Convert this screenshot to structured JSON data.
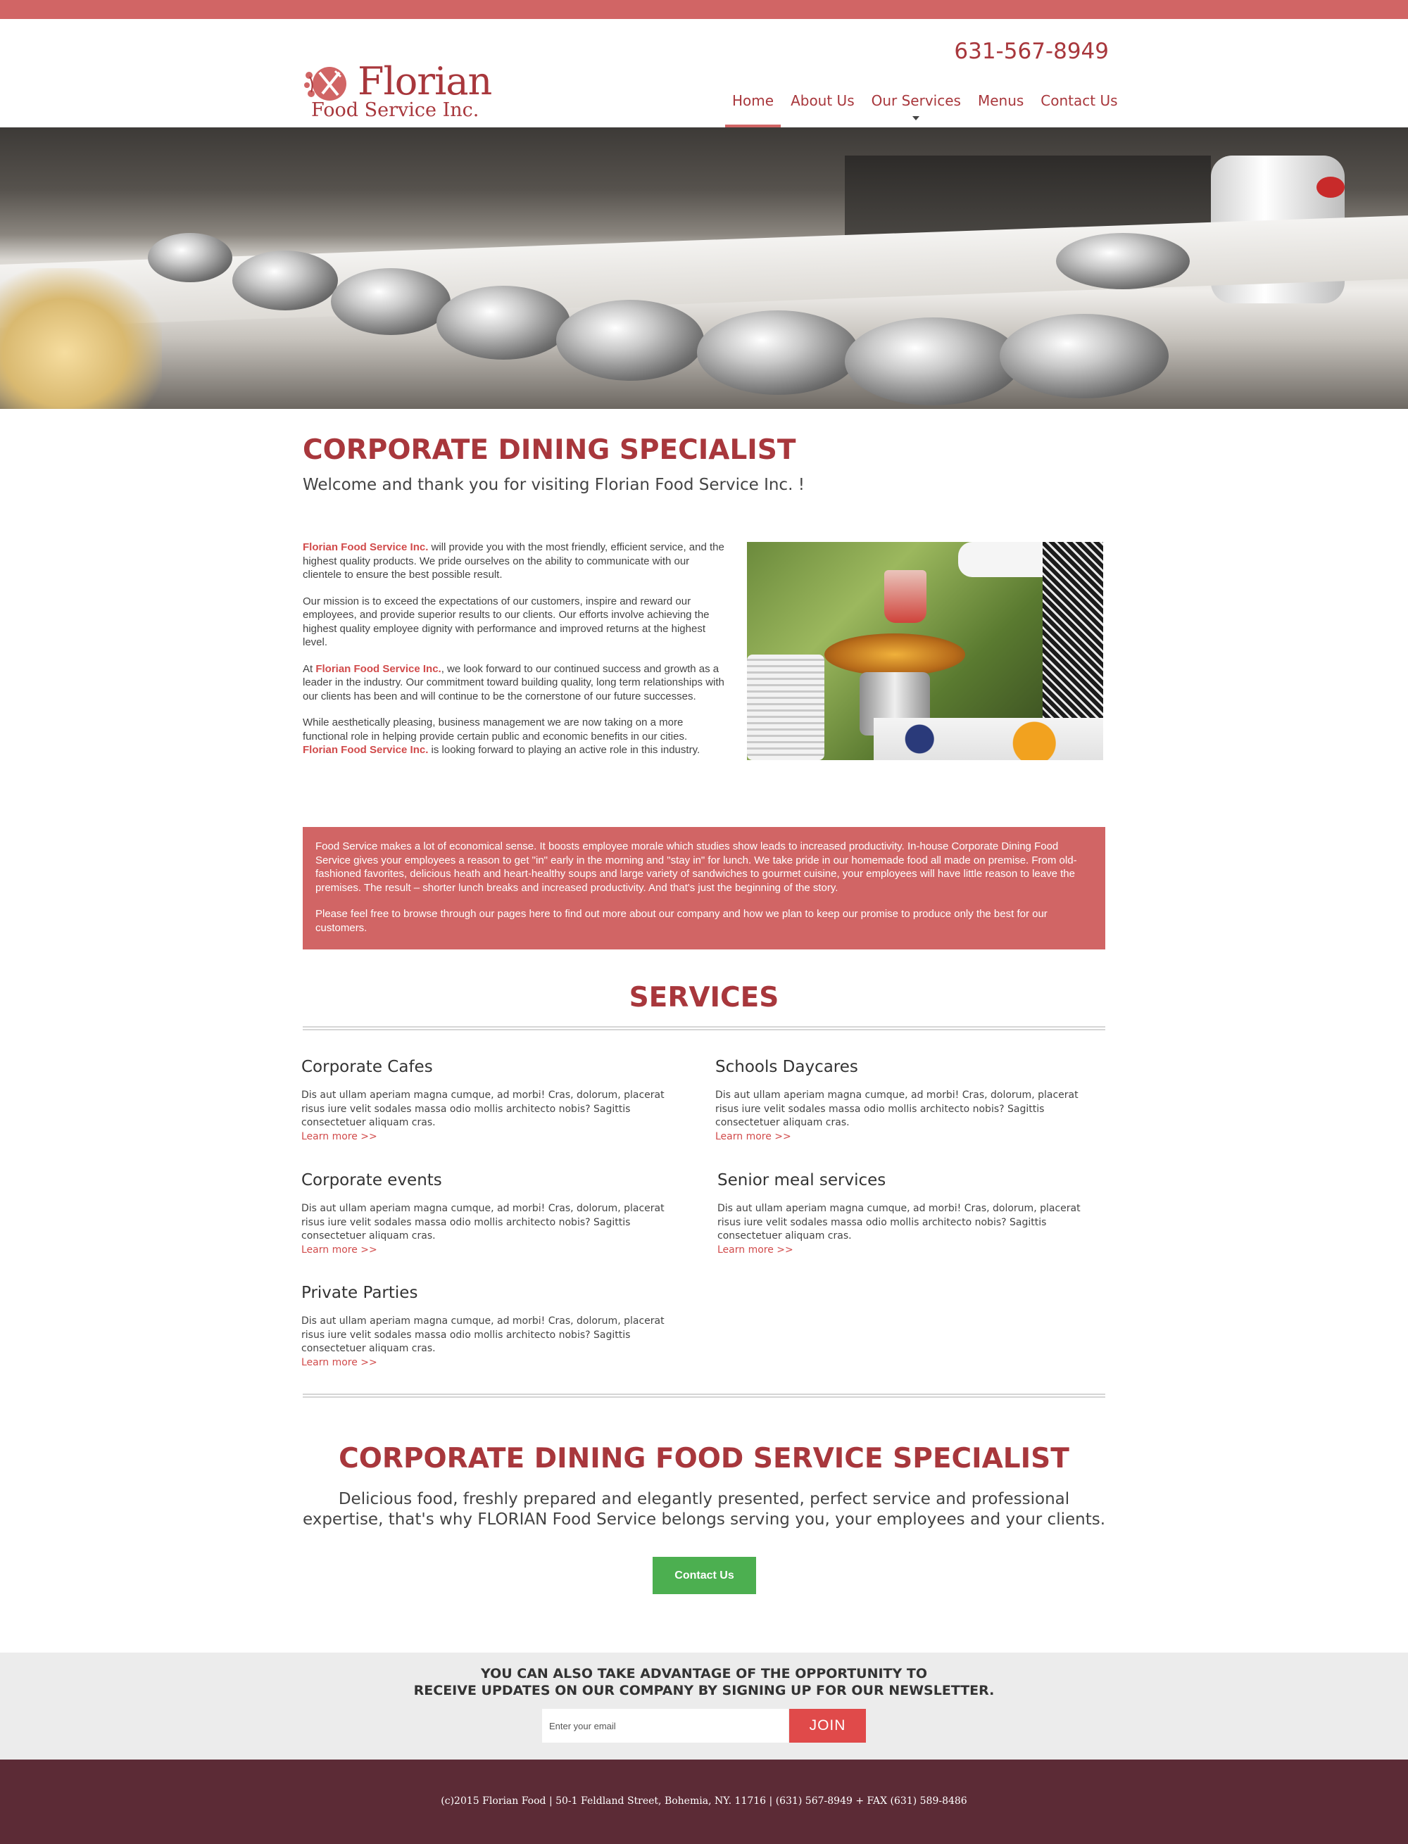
{
  "colors": {
    "brand": "#a8373c",
    "accent": "#d16565",
    "footer": "#5c2b36",
    "cta_button": "#4caf50",
    "join_button": "#e04a4a"
  },
  "header": {
    "logo_name": "Florian",
    "logo_sub": "Food Service Inc.",
    "phone": "631-567-8949",
    "nav": [
      {
        "label": "Home",
        "active": true
      },
      {
        "label": "About Us"
      },
      {
        "label": "Our Services",
        "has_dropdown": true
      },
      {
        "label": "Menus"
      },
      {
        "label": "Contact Us"
      }
    ]
  },
  "intro": {
    "title": "CORPORATE DINING SPECIALIST",
    "welcome": "Welcome and thank you for visiting Florian  Food Service Inc. !",
    "p1_brand": "Florian  Food Service Inc.",
    "p1_text": " will provide you with the most friendly, efficient service, and the highest quality products. We pride ourselves on the ability to communicate with our clientele to ensure the best possible result.",
    "p2_text": "Our mission is to exceed the expectations of our customers, inspire and reward our employees, and provide superior results to our clients. Our efforts involve achieving the highest quality employee dignity with performance and improved returns at the highest level.",
    "p3_prefix": "At ",
    "p3_brand": "Florian  Food Service Inc.",
    "p3_text": ", we look forward to our continued success and growth as a leader in the industry.  Our commitment toward building quality, long term relationships with our clients has been and will continue to be the cornerstone of our future successes.",
    "p4_text": "While aesthetically pleasing, business management we are now taking on a more functional role in helping provide certain public and economic benefits in our cities.",
    "p4_brand": "Florian  Food Service Inc.",
    "p4_suffix": " is looking forward to playing an active role in this industry."
  },
  "callout": {
    "p1": "Food Service makes a lot of economical sense. It boosts employee morale which studies show leads to increased productivity. In-house Corporate Dining Food Service gives your employees a reason to get \"in\" early in the morning and \"stay in\" for lunch. We take pride in our homemade food all made on premise. From old-fashioned favorites, delicious heath and heart-healthy soups and large variety of sandwiches to gourmet cuisine, your employees will have little reason to leave the premises. The result – shorter lunch breaks and increased productivity. And that's just the beginning of the story.",
    "p2": "Please feel free to browse through our pages here to find out more about our company and how we plan to keep our promise to produce only the best for our customers."
  },
  "services": {
    "title": "SERVICES",
    "items": [
      {
        "title": "Corporate Cafes",
        "desc": "Dis aut ullam aperiam magna cumque, ad morbi! Cras, dolorum, placerat risus iure velit sodales massa odio mollis architecto nobis? Sagittis consectetuer aliquam cras.",
        "link": "Learn more >>"
      },
      {
        "title": "Schools Daycares",
        "desc": "Dis aut ullam aperiam magna cumque, ad morbi! Cras, dolorum, placerat risus iure velit sodales massa odio mollis architecto nobis? Sagittis consectetuer aliquam cras.",
        "link": "Learn more >>"
      },
      {
        "title": "Corporate events",
        "desc": "Dis aut ullam aperiam magna cumque, ad morbi! Cras, dolorum, placerat risus iure velit sodales massa odio mollis architecto nobis? Sagittis consectetuer aliquam cras.",
        "link": "Learn more >>"
      },
      {
        "title": "Senior meal services",
        "desc": "Dis aut ullam aperiam magna cumque, ad morbi! Cras, dolorum, placerat risus iure velit sodales massa odio mollis architecto nobis? Sagittis consectetuer aliquam cras.",
        "link": "Learn more >>"
      },
      {
        "title": "Private Parties",
        "desc": "Dis aut ullam aperiam magna cumque, ad morbi! Cras, dolorum, placerat risus iure velit sodales massa odio mollis architecto nobis? Sagittis consectetuer aliquam cras.",
        "link": "Learn more >>"
      }
    ]
  },
  "cta": {
    "title": "CORPORATE DINING FOOD SERVICE SPECIALIST",
    "text": "Delicious food, freshly prepared and elegantly presented, perfect service and professional expertise, that's why FLORIAN Food Service belongs serving you, your employees and your clients.",
    "button": "Contact Us"
  },
  "newsletter": {
    "line1": "YOU CAN ALSO TAKE ADVANTAGE OF THE OPPORTUNITY TO",
    "line2": "RECEIVE UPDATES ON OUR COMPANY BY SIGNING UP FOR OUR NEWSLETTER.",
    "placeholder": "Enter your email",
    "button": "JOIN"
  },
  "footer": {
    "text": "(c)2015 Florian Food | 50-1 Feldland Street, Bohemia, NY. 11716 | (631) 567-8949  + FAX (631) 589-8486"
  }
}
